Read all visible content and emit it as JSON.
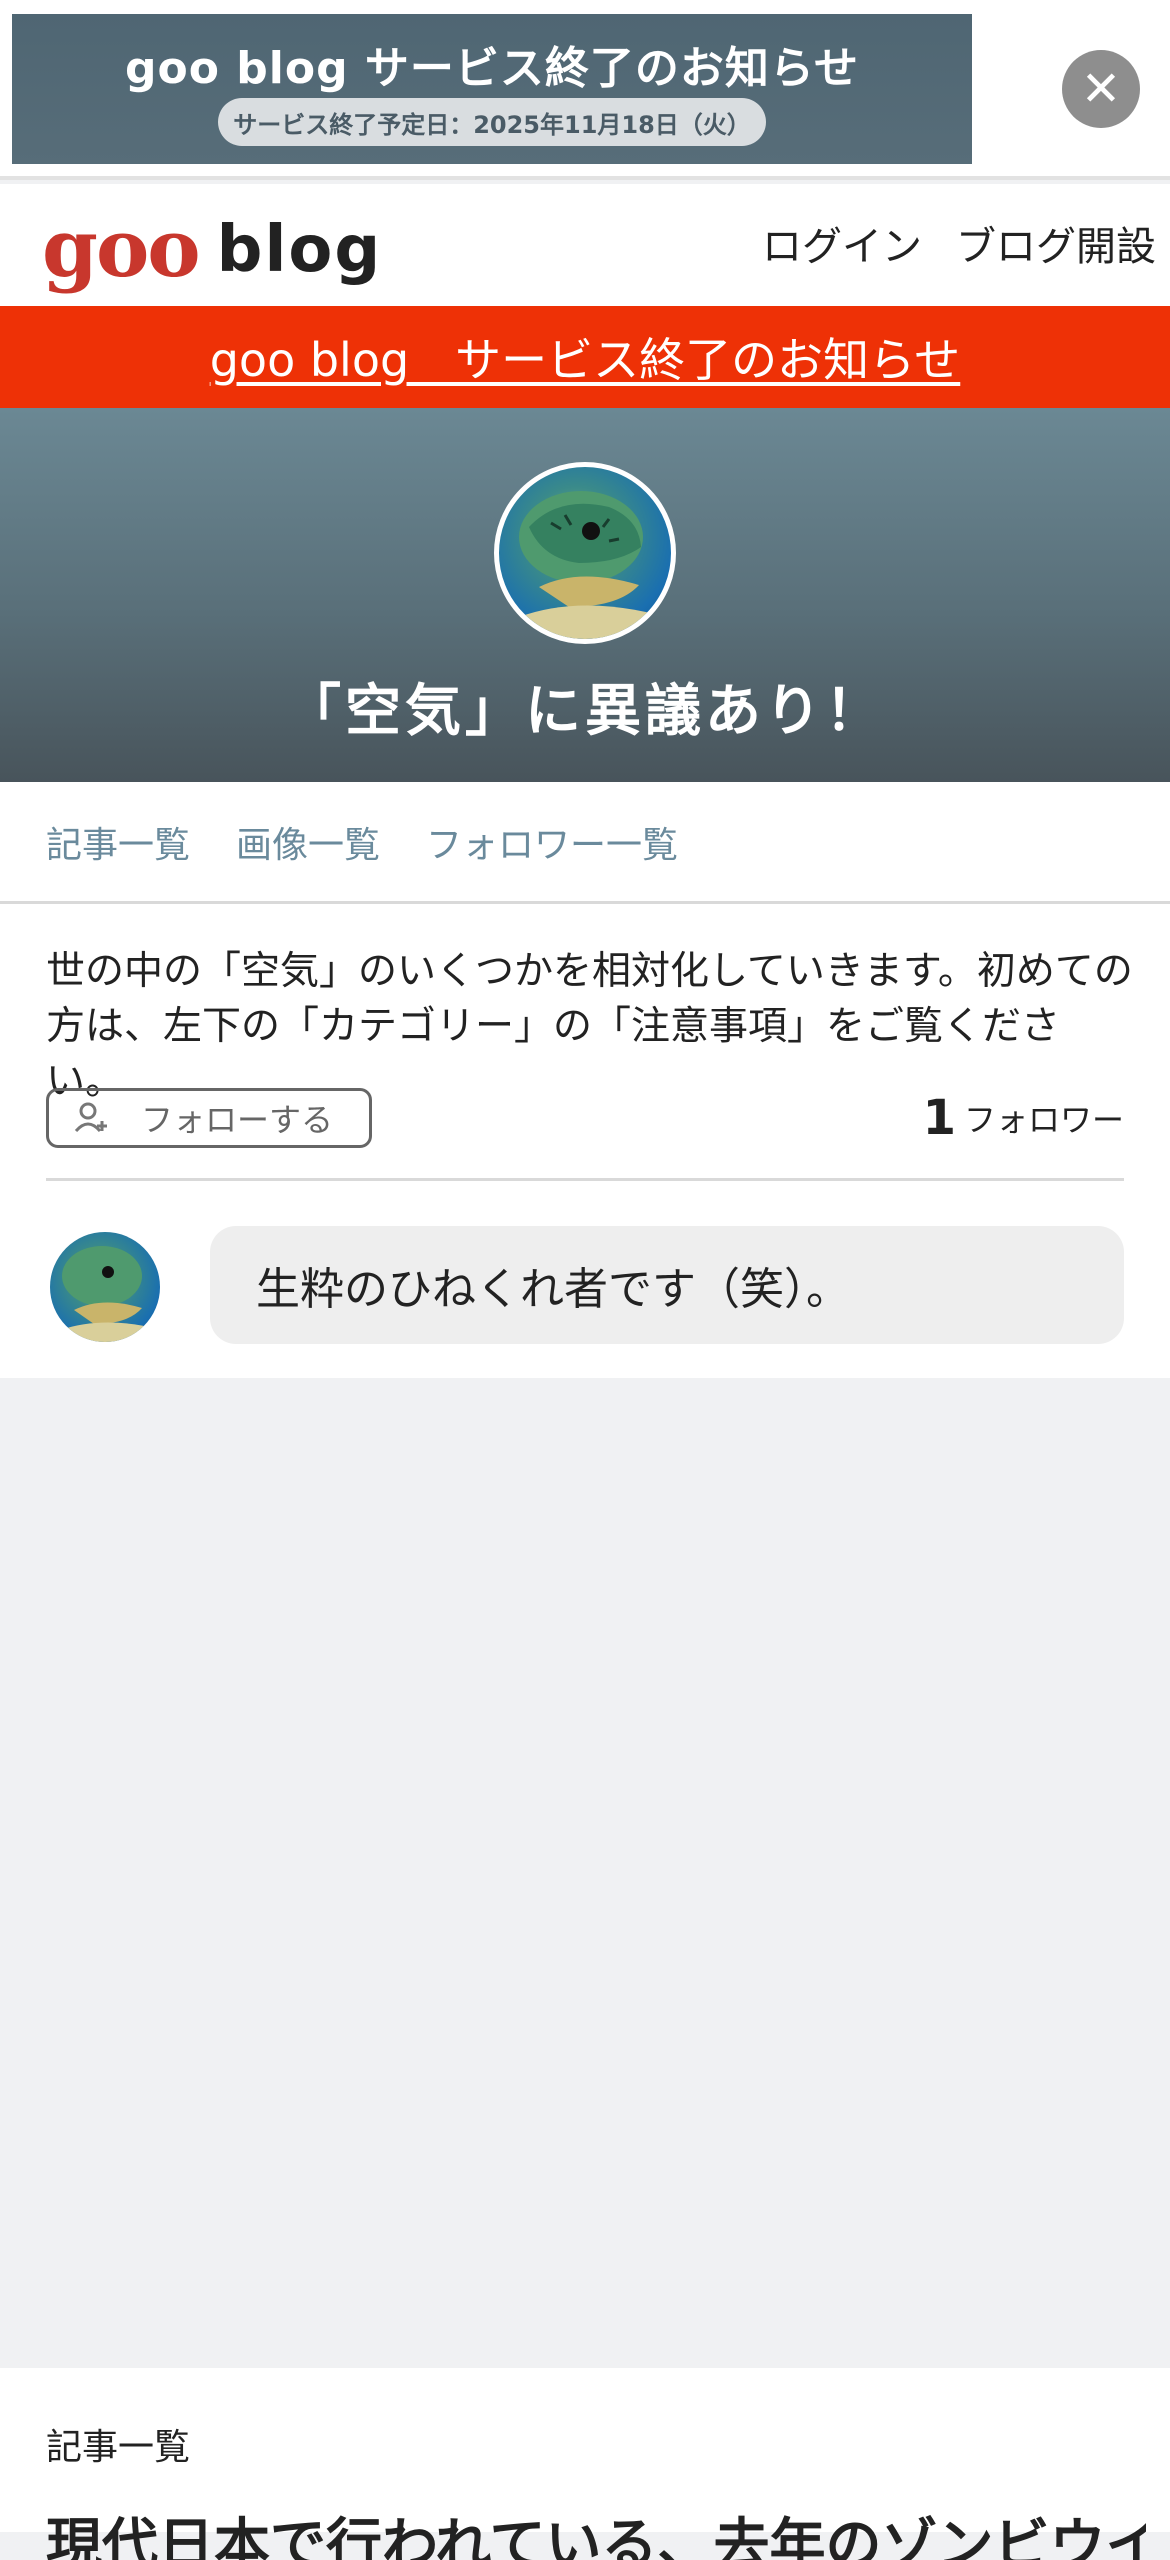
{
  "banner": {
    "title": "goo blog サービス終了のお知らせ",
    "end_date": "サービス終了予定日：2025年11月18日（火）",
    "close_label": "✕"
  },
  "header": {
    "logo_goo": "goo",
    "logo_blog": "blog",
    "login": "ログイン",
    "open_blog": "ブログ開設"
  },
  "notice": {
    "text": "goo blog　サービス終了のお知らせ"
  },
  "hero": {
    "blog_title": "「空気」に異議あり！"
  },
  "tabs": [
    {
      "label": "記事一覧"
    },
    {
      "label": "画像一覧"
    },
    {
      "label": "フォロワー一覧"
    }
  ],
  "profile": {
    "description": "世の中の「空気」のいくつかを相対化していきます。初めての方は、左下の「カテゴリー」の「注意事項」をご覧ください。",
    "follow_button": "フォローする",
    "follower_count": "1",
    "follower_label": "フォロワー",
    "bio": "生粋のひねくれ者です（笑）。"
  },
  "article_list": {
    "label": "記事一覧",
    "first_title": "現代日本で行われている、去年のゾンビウイルス級の"
  },
  "colors": {
    "brand_red": "#c8372d",
    "notice_bar": "#ee3106",
    "tab_text": "#6a8a9c"
  }
}
